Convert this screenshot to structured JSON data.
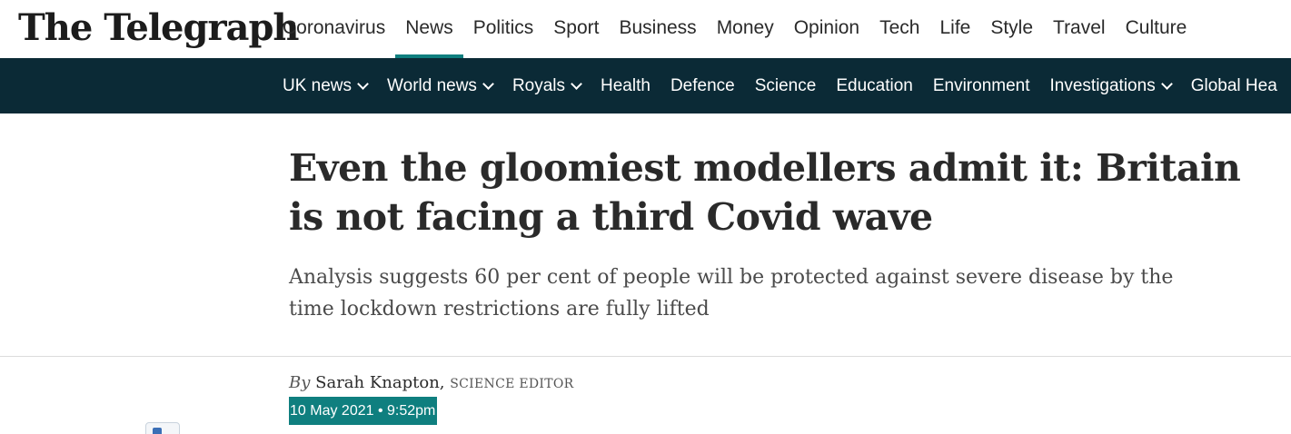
{
  "brand": {
    "logo_text": "The Telegraph"
  },
  "primary_nav": {
    "items": [
      {
        "label": "Coronavirus"
      },
      {
        "label": "News",
        "active": true
      },
      {
        "label": "Politics"
      },
      {
        "label": "Sport"
      },
      {
        "label": "Business"
      },
      {
        "label": "Money"
      },
      {
        "label": "Opinion"
      },
      {
        "label": "Tech"
      },
      {
        "label": "Life"
      },
      {
        "label": "Style"
      },
      {
        "label": "Travel"
      },
      {
        "label": "Culture"
      }
    ]
  },
  "secondary_nav": {
    "items": [
      {
        "label": "UK news",
        "has_dropdown": true
      },
      {
        "label": "World news",
        "has_dropdown": true
      },
      {
        "label": "Royals",
        "has_dropdown": true
      },
      {
        "label": "Health"
      },
      {
        "label": "Defence"
      },
      {
        "label": "Science"
      },
      {
        "label": "Education"
      },
      {
        "label": "Environment"
      },
      {
        "label": "Investigations",
        "has_dropdown": true
      },
      {
        "label": "Global Hea"
      }
    ]
  },
  "article": {
    "headline": "Even the gloomiest modellers admit it: Britain is not facing a third Covid wave",
    "standfirst": "Analysis suggests 60 per cent of people will be protected against severe disease by the time lockdown restrictions are fully lifted",
    "byline_prefix": "By",
    "author": "Sarah Knapton,",
    "author_role": "SCIENCE EDITOR",
    "timestamp": "10 May 2021 • 9:52pm"
  },
  "colors": {
    "accent": "#0f7f7f",
    "secondary_nav_bg": "#0b2a36",
    "text": "#2a2a2a"
  },
  "icons": {
    "partial_icon": "share-icon"
  }
}
